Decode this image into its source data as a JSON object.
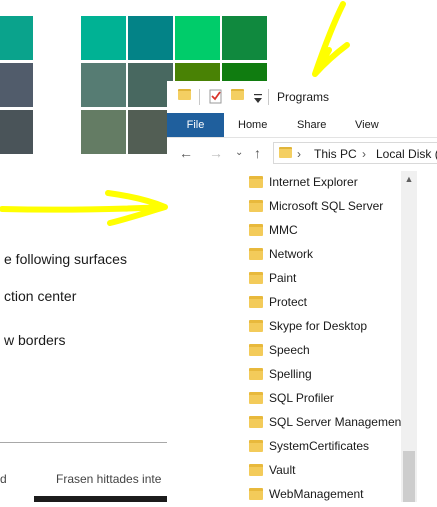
{
  "swatches": [
    {
      "color": "#0aa38c"
    },
    {
      "color": "#00b294"
    },
    {
      "color": "#038387"
    },
    {
      "color": "#00cc6a"
    },
    {
      "color": "#10893e"
    },
    {
      "color": "#515c6b"
    },
    {
      "color": "#567c73"
    },
    {
      "color": "#486860"
    },
    {
      "color": "#498205"
    },
    {
      "color": "#107c10"
    },
    {
      "color": "#4a5459"
    },
    {
      "color": "#647c64"
    },
    {
      "color": "#525e54"
    },
    {
      "color": "#847545"
    },
    {
      "color": "#7e735f"
    }
  ],
  "background": {
    "line1": "e following surfaces",
    "line2": "ction center",
    "line3": "w borders",
    "search_left": "d",
    "search_right": "Frasen hittades inte"
  },
  "explorer": {
    "title": "Programs",
    "ribbon_tabs": {
      "file": "File",
      "home": "Home",
      "share": "Share",
      "view": "View"
    },
    "address": {
      "this_pc": "This PC",
      "local_disk": "Local Disk ("
    },
    "folders": [
      "Internet Explorer",
      "Microsoft SQL Server",
      "MMC",
      "Network",
      "Paint",
      "Protect",
      "Skype for Desktop",
      "Speech",
      "Spelling",
      "SQL Profiler",
      "SQL Server Management",
      "SystemCertificates",
      "Vault",
      "WebManagement"
    ]
  },
  "annotation_color": "#ffff00"
}
